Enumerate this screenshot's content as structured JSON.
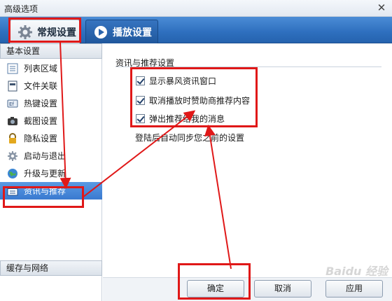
{
  "window": {
    "title": "高级选项",
    "close_glyph": "✕"
  },
  "tabs": [
    {
      "label": "常规设置",
      "icon": "gear-icon",
      "active": true
    },
    {
      "label": "播放设置",
      "icon": "play-settings-icon",
      "active": false
    }
  ],
  "sidebar": {
    "section_basic": "基本设置",
    "items": [
      {
        "label": "列表区域",
        "icon": "list-icon"
      },
      {
        "label": "文件关联",
        "icon": "file-icon"
      },
      {
        "label": "热键设置",
        "icon": "hotkey-icon"
      },
      {
        "label": "截图设置",
        "icon": "camera-icon"
      },
      {
        "label": "隐私设置",
        "icon": "lock-icon"
      },
      {
        "label": "启动与退出",
        "icon": "gear-icon"
      },
      {
        "label": "升级与更新",
        "icon": "globe-icon"
      },
      {
        "label": "资讯与推荐",
        "icon": "window-icon",
        "active": true
      }
    ],
    "section_cache": "缓存与网络"
  },
  "content": {
    "group_title": "资讯与推荐设置",
    "options": [
      {
        "label": "显示暴风资讯窗口",
        "checked": true
      },
      {
        "label": "取消播放时赞助商推荐内容",
        "checked": true
      },
      {
        "label": "弹出推荐给我的消息",
        "checked": true
      }
    ],
    "hint": "登陆后自动同步您之前的设置"
  },
  "buttons": {
    "ok": "确定",
    "cancel": "取消",
    "apply": "应用"
  },
  "watermark": "Baidu 经验",
  "colors": {
    "tab_bar": "#2e6fbe",
    "active_item": "#3a7ad0",
    "annotation": "#e01818"
  }
}
